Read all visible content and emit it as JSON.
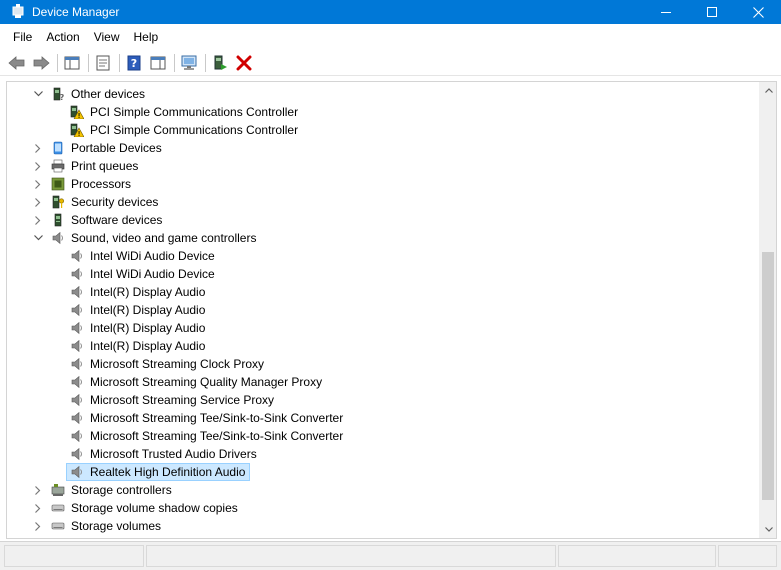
{
  "window": {
    "title": "Device Manager",
    "controls": {
      "minimize": "—",
      "maximize": "☐",
      "close": "✕"
    }
  },
  "menu": [
    "File",
    "Action",
    "View",
    "Help"
  ],
  "toolbar": [
    {
      "icon": "back-arrow-icon"
    },
    {
      "icon": "forward-arrow-icon"
    },
    {
      "icon": "show-hide-console-tree-icon"
    },
    {
      "icon": "properties-icon"
    },
    {
      "icon": "help-icon"
    },
    {
      "icon": "action-pane-icon"
    },
    {
      "icon": "scan-hardware-icon"
    },
    {
      "icon": "update-driver-icon"
    },
    {
      "icon": "uninstall-device-icon"
    }
  ],
  "tree": [
    {
      "label": "Other devices",
      "level": 0,
      "expanded": true,
      "icon": "other-devices-icon"
    },
    {
      "label": "PCI Simple Communications Controller",
      "level": 1,
      "icon": "warning-device-icon"
    },
    {
      "label": "PCI Simple Communications Controller",
      "level": 1,
      "icon": "warning-device-icon"
    },
    {
      "label": "Portable Devices",
      "level": 0,
      "expanded": false,
      "icon": "portable-device-icon"
    },
    {
      "label": "Print queues",
      "level": 0,
      "expanded": false,
      "icon": "printer-icon"
    },
    {
      "label": "Processors",
      "level": 0,
      "expanded": false,
      "icon": "processor-icon"
    },
    {
      "label": "Security devices",
      "level": 0,
      "expanded": false,
      "icon": "security-device-icon"
    },
    {
      "label": "Software devices",
      "level": 0,
      "expanded": false,
      "icon": "software-device-icon"
    },
    {
      "label": "Sound, video and game controllers",
      "level": 0,
      "expanded": true,
      "icon": "speaker-icon"
    },
    {
      "label": "Intel WiDi Audio Device",
      "level": 1,
      "icon": "speaker-icon"
    },
    {
      "label": "Intel WiDi Audio Device",
      "level": 1,
      "icon": "speaker-icon"
    },
    {
      "label": "Intel(R) Display Audio",
      "level": 1,
      "icon": "speaker-icon"
    },
    {
      "label": "Intel(R) Display Audio",
      "level": 1,
      "icon": "speaker-icon"
    },
    {
      "label": "Intel(R) Display Audio",
      "level": 1,
      "icon": "speaker-icon"
    },
    {
      "label": "Intel(R) Display Audio",
      "level": 1,
      "icon": "speaker-icon"
    },
    {
      "label": "Microsoft Streaming Clock Proxy",
      "level": 1,
      "icon": "speaker-icon"
    },
    {
      "label": "Microsoft Streaming Quality Manager Proxy",
      "level": 1,
      "icon": "speaker-icon"
    },
    {
      "label": "Microsoft Streaming Service Proxy",
      "level": 1,
      "icon": "speaker-icon"
    },
    {
      "label": "Microsoft Streaming Tee/Sink-to-Sink Converter",
      "level": 1,
      "icon": "speaker-icon"
    },
    {
      "label": "Microsoft Streaming Tee/Sink-to-Sink Converter",
      "level": 1,
      "icon": "speaker-icon"
    },
    {
      "label": "Microsoft Trusted Audio Drivers",
      "level": 1,
      "icon": "speaker-icon"
    },
    {
      "label": "Realtek High Definition Audio",
      "level": 1,
      "icon": "speaker-icon",
      "selected": true
    },
    {
      "label": "Storage controllers",
      "level": 0,
      "expanded": false,
      "icon": "storage-controller-icon"
    },
    {
      "label": "Storage volume shadow copies",
      "level": 0,
      "expanded": false,
      "icon": "drive-icon"
    },
    {
      "label": "Storage volumes",
      "level": 0,
      "expanded": false,
      "icon": "drive-icon"
    }
  ],
  "colors": {
    "titlebar": "#0078d7",
    "selection": "#cce8ff",
    "selection_border": "#99d1ff",
    "delete_red": "#d00000"
  }
}
